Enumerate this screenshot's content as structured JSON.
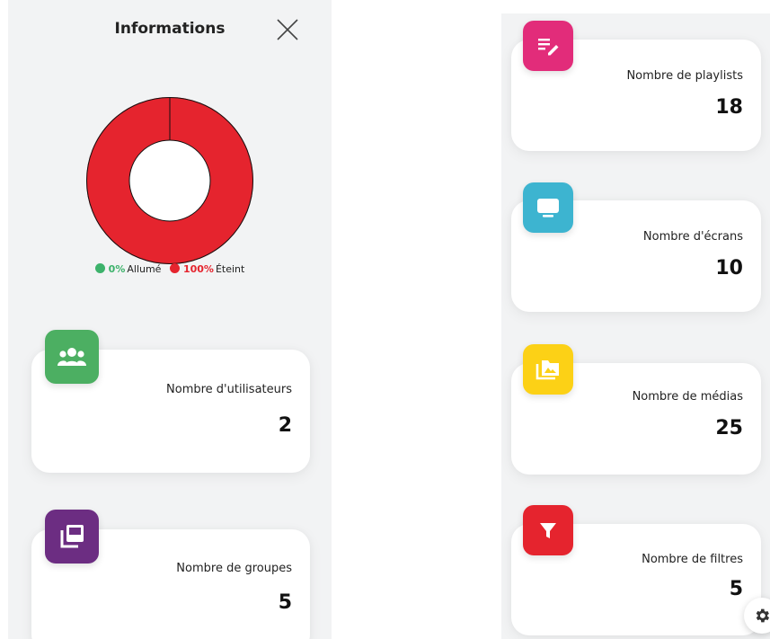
{
  "header": {
    "title": "Informations"
  },
  "colors": {
    "on": "#3db26b",
    "off": "#e5242e",
    "users": "#4caf62",
    "groups": "#6c2d82",
    "playlists": "#e22c7a",
    "screens": "#3db4d0",
    "media": "#fcd116",
    "filters": "#e5242e"
  },
  "chart_data": {
    "type": "pie",
    "categories": [
      "Allumé",
      "Éteint"
    ],
    "values": [
      0,
      100
    ],
    "unit": "%"
  },
  "legend": {
    "on": {
      "percent": "0%",
      "label": "Allumé"
    },
    "off": {
      "percent": "100%",
      "label": "Éteint"
    }
  },
  "stats": {
    "users": {
      "label": "Nombre d'utilisateurs",
      "value": "2",
      "icon": "users-group-icon"
    },
    "groups": {
      "label": "Nombre de groupes",
      "value": "5",
      "icon": "library-stack-icon"
    },
    "playlists": {
      "label": "Nombre de playlists",
      "value": "18",
      "icon": "playlist-edit-icon"
    },
    "screens": {
      "label": "Nombre d'écrans",
      "value": "10",
      "icon": "screen-icon"
    },
    "media": {
      "label": "Nombre de médias",
      "value": "25",
      "icon": "media-folder-icon"
    },
    "filters": {
      "label": "Nombre de filtres",
      "value": "5",
      "icon": "filter-icon"
    }
  },
  "fab": {
    "icon": "gear-icon"
  }
}
